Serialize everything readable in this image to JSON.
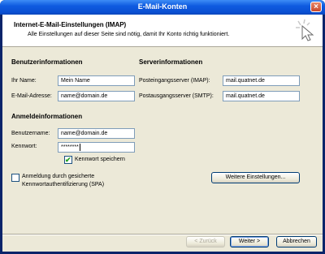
{
  "window": {
    "title": "E-Mail-Konten",
    "close_glyph": "×"
  },
  "header": {
    "title": "Internet-E-Mail-Einstellungen (IMAP)",
    "subtitle": "Alle Einstellungen auf dieser Seite sind nötig, damit Ihr Konto richtig funktioniert.",
    "icon": "wizard-cursor-icon"
  },
  "user_info": {
    "heading": "Benutzerinformationen",
    "name_label": "Ihr Name:",
    "name_value": "Mein Name",
    "email_label": "E-Mail-Adresse:",
    "email_value": "name@domain.de"
  },
  "server_info": {
    "heading": "Serverinformationen",
    "incoming_label": "Posteingangsserver (IMAP):",
    "incoming_value": "mail.quatnet.de",
    "outgoing_label": "Postausgangsserver (SMTP):",
    "outgoing_value": "mail.quatnet.de"
  },
  "login_info": {
    "heading": "Anmeldeinformationen",
    "username_label": "Benutzername:",
    "username_value": "name@domain.de",
    "password_label": "Kennwort:",
    "password_value": "********",
    "remember_label": "Kennwort speichern",
    "remember_checked": true
  },
  "spa": {
    "label_line1": "Anmeldung durch gesicherte",
    "label_line2": "Kennwortauthentifizierung (SPA)",
    "checked": false
  },
  "buttons": {
    "more_settings": "Weitere Einstellungen...",
    "back": "< Zurück",
    "next": "Weiter >",
    "cancel": "Abbrechen"
  },
  "colors": {
    "titlebar": "#0f5be0",
    "dialog_bg": "#ece9d8",
    "check": "#21a121"
  }
}
